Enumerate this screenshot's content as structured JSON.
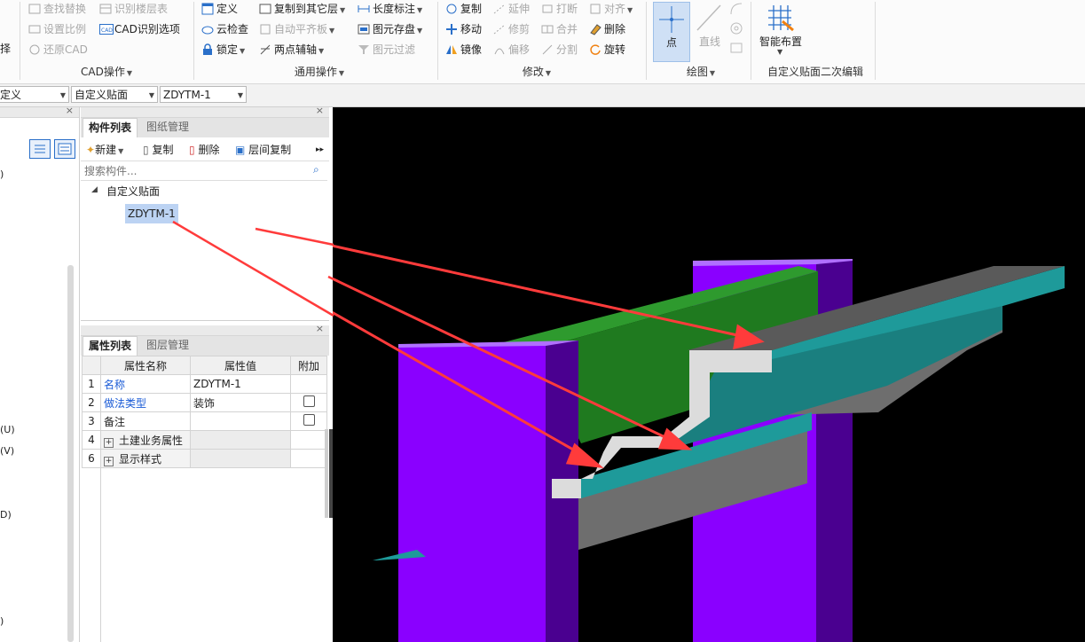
{
  "ribbon": {
    "cad_ops": {
      "items": [
        "查找替换",
        "识别楼层表",
        "设置比例",
        "CAD识别选项",
        "还原CAD"
      ],
      "group_label": "CAD操作",
      "left_cut": "择"
    },
    "general_ops": {
      "items": [
        "定义",
        "复制到其它层",
        "长度标注",
        "云检查",
        "自动平齐板",
        "图元存盘",
        "锁定",
        "两点辅轴",
        "图元过滤"
      ],
      "group_label": "通用操作"
    },
    "modify": {
      "items": [
        "复制",
        "延伸",
        "打断",
        "对齐",
        "移动",
        "修剪",
        "合并",
        "删除",
        "镜像",
        "偏移",
        "分割",
        "旋转"
      ],
      "group_label": "修改"
    },
    "draw": {
      "items": [
        "点",
        "直线"
      ],
      "group_label": "绘图"
    },
    "smart": {
      "items": [
        "智能布置"
      ],
      "group_label": "自定义贴面二次编辑"
    }
  },
  "combos": [
    "定义",
    "自定义贴面",
    "ZDYTM-1"
  ],
  "left_panel": {
    "fragments": [
      ")",
      "(U)",
      "(V)",
      "D)",
      ")"
    ]
  },
  "component_panel": {
    "tabs": [
      "构件列表",
      "图纸管理"
    ],
    "toolbar": [
      "新建",
      "复制",
      "删除",
      "层间复制"
    ],
    "search_placeholder": "搜索构件...",
    "tree": {
      "parent": "自定义贴面",
      "child": "ZDYTM-1"
    }
  },
  "property_panel": {
    "tabs": [
      "属性列表",
      "图层管理"
    ],
    "headers": [
      "属性名称",
      "属性值",
      "附加"
    ],
    "rows": [
      {
        "num": "1",
        "name": "名称",
        "value": "ZDYTM-1",
        "link": true,
        "checkbox": false,
        "expander": false
      },
      {
        "num": "2",
        "name": "做法类型",
        "value": "装饰",
        "link": true,
        "checkbox": true,
        "expander": false
      },
      {
        "num": "3",
        "name": "备注",
        "value": "",
        "link": false,
        "checkbox": true,
        "expander": false
      },
      {
        "num": "4",
        "name": "土建业务属性",
        "value": "",
        "link": false,
        "checkbox": false,
        "expander": true
      },
      {
        "num": "6",
        "name": "显示样式",
        "value": "",
        "link": false,
        "checkbox": false,
        "expander": true
      }
    ]
  },
  "colors": {
    "viewport_bg": "#000000",
    "column": "#8a00ff",
    "column_side": "#4a0090",
    "beam": "#1f7a1f",
    "facing_top": "#1e9a9a",
    "facing_grey": "#6e6e6e",
    "facing_light": "#dcdcdc",
    "arrow": "#ff3b3b",
    "link_text": "#1a5bd6",
    "selection": "#bcd3f3"
  }
}
